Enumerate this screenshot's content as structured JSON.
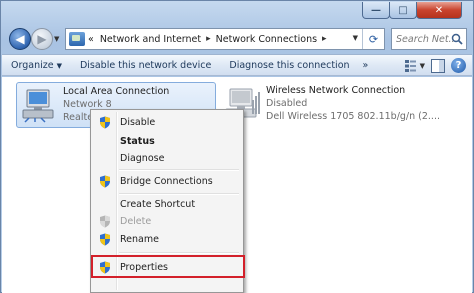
{
  "window": {
    "minimize_glyph": "—",
    "maximize_glyph": "□",
    "close_glyph": "✕"
  },
  "nav": {
    "back_glyph": "◀",
    "forward_glyph": "▶",
    "recent_glyph": "▼"
  },
  "address": {
    "prefix": "«",
    "crumbs": [
      "Network and Internet",
      "Network Connections"
    ],
    "separator": "▸",
    "dropdown_glyph": "▼",
    "refresh_glyph": "⟳"
  },
  "search": {
    "placeholder": "Search Net..."
  },
  "commandbar": {
    "organize": "Organize",
    "organize_arrow": "▼",
    "disable_device": "Disable this network device",
    "diagnose": "Diagnose this connection",
    "more": "»",
    "help_glyph": "?"
  },
  "connections": [
    {
      "name": "Local Area Connection",
      "status": "Network  8",
      "device": "Realtek"
    },
    {
      "name": "Wireless Network Connection",
      "status": "Disabled",
      "device": "Dell Wireless 1705 802.11b/g/n (2...."
    }
  ],
  "context_menu": {
    "items": [
      {
        "label": "Disable",
        "shield": true,
        "bold": false,
        "disabled": false
      },
      {
        "label": "Status",
        "shield": false,
        "bold": true,
        "disabled": false
      },
      {
        "label": "Diagnose",
        "shield": false,
        "bold": false,
        "disabled": false
      },
      {
        "label": "Bridge Connections",
        "shield": true,
        "bold": false,
        "disabled": false
      },
      {
        "label": "Create Shortcut",
        "shield": false,
        "bold": false,
        "disabled": false
      },
      {
        "label": "Delete",
        "shield": true,
        "bold": false,
        "disabled": true
      },
      {
        "label": "Rename",
        "shield": true,
        "bold": false,
        "disabled": false
      },
      {
        "label": "Properties",
        "shield": true,
        "bold": false,
        "disabled": false
      }
    ]
  },
  "colors": {
    "highlight_border": "#d3202a",
    "selection_bg": "#cfe1f6"
  }
}
